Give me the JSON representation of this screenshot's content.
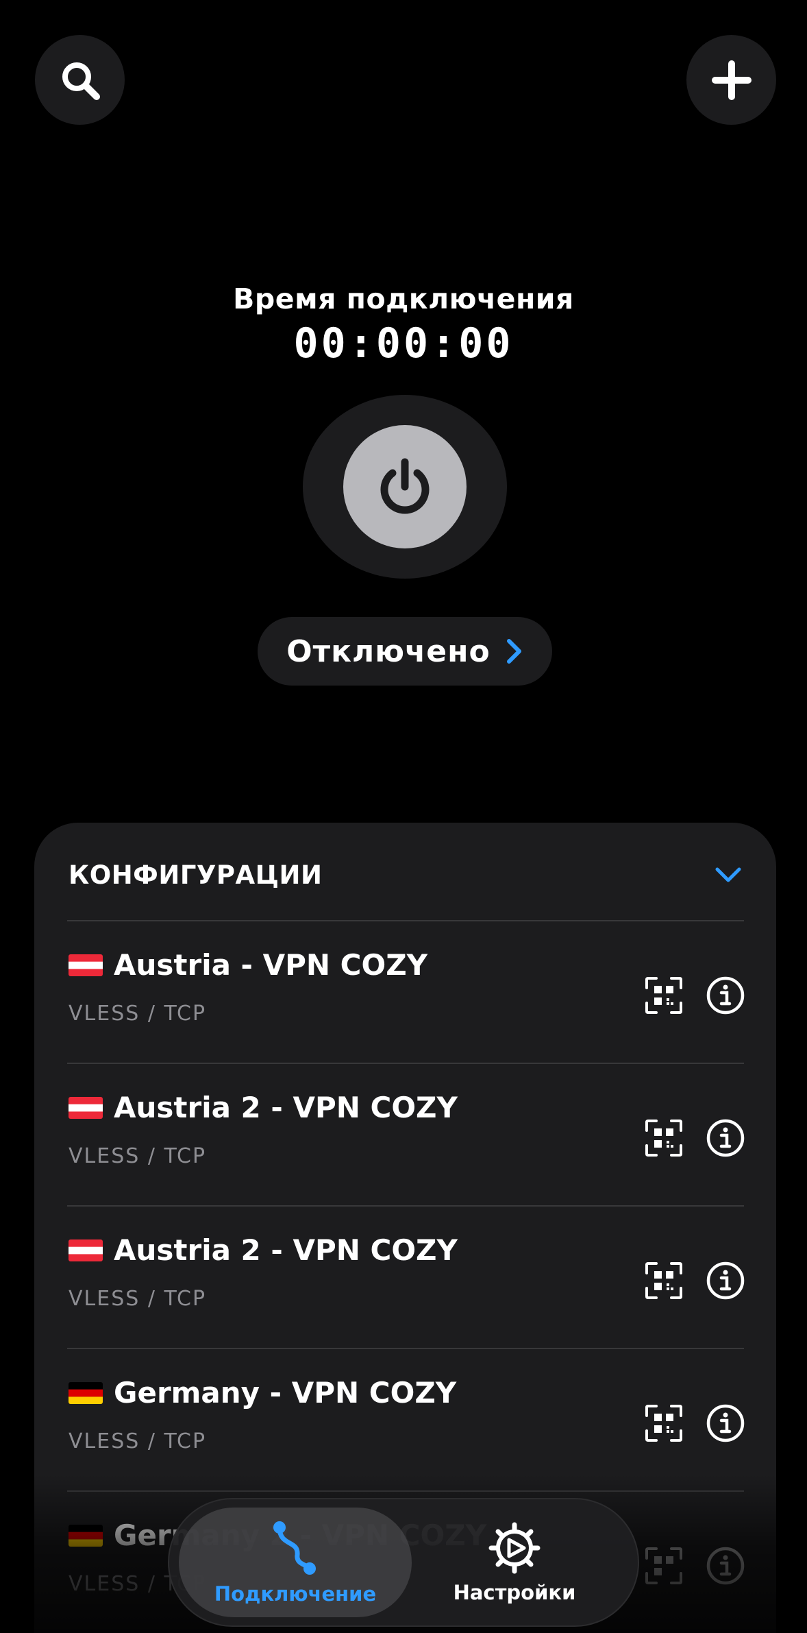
{
  "header": {
    "search_icon": "magnifier-icon",
    "add_icon": "plus-icon"
  },
  "connection": {
    "time_label": "Время подключения",
    "time_value": "00:00:00",
    "power_icon": "power-icon",
    "status": "Отключено"
  },
  "configs": {
    "title": "КОНФИГУРАЦИИ",
    "items": [
      {
        "flag": "austria",
        "name": "Austria - VPN COZY",
        "protocol": "VLESS / TCP"
      },
      {
        "flag": "austria",
        "name": "Austria 2 - VPN COZY",
        "protocol": "VLESS / TCP"
      },
      {
        "flag": "austria",
        "name": "Austria 2 - VPN COZY",
        "protocol": "VLESS / TCP"
      },
      {
        "flag": "germany",
        "name": "Germany - VPN COZY",
        "protocol": "VLESS / TCP"
      },
      {
        "flag": "germany",
        "name": "Germany 2 - VPN COZY",
        "protocol": "VLESS / TCP"
      }
    ]
  },
  "tabbar": {
    "tabs": [
      {
        "label": "Подключение",
        "icon": "route-icon",
        "active": true
      },
      {
        "label": "Настройки",
        "icon": "gear-icon",
        "active": false
      }
    ]
  },
  "colors": {
    "accent": "#2f9bff",
    "background": "#000000",
    "surface": "#1c1c1e",
    "power_button": "#b8b8bc",
    "secondary_text": "#8e8e93"
  }
}
